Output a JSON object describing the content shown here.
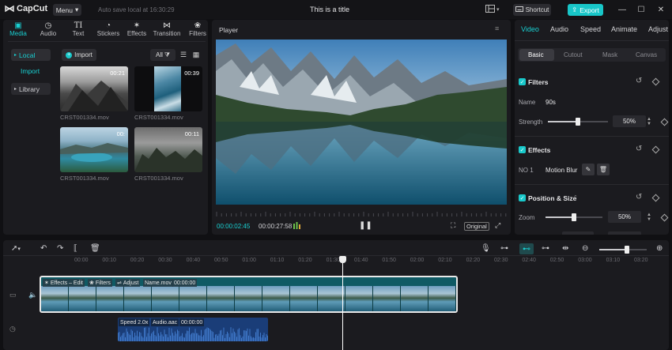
{
  "app": {
    "name": "CapCut",
    "menu_label": "Menu",
    "autosave": "Auto save local at 16:30:29",
    "title": "This is a title",
    "shortcut_label": "Shortcut",
    "export_label": "Export"
  },
  "media_tabs": [
    {
      "label": "Media",
      "icon": "media-icon"
    },
    {
      "label": "Audio",
      "icon": "audio-icon"
    },
    {
      "label": "Text",
      "icon": "text-icon"
    },
    {
      "label": "Stickers",
      "icon": "stickers-icon"
    },
    {
      "label": "Effects",
      "icon": "effects-icon"
    },
    {
      "label": "Transition",
      "icon": "transition-icon"
    },
    {
      "label": "Filters",
      "icon": "filters-icon"
    }
  ],
  "media_sidebar": {
    "local": "Local",
    "import": "Import",
    "library": "Library"
  },
  "media_toolbar": {
    "import": "Import",
    "filter_all": "All"
  },
  "media_items": [
    {
      "name": "CRST001334.mov",
      "duration": "00:21"
    },
    {
      "name": "CRST001334.mov",
      "duration": "00:39"
    },
    {
      "name": "CRST001334.mov",
      "duration": "00:"
    },
    {
      "name": "CRST001334.mov",
      "duration": "00:11"
    }
  ],
  "player": {
    "title": "Player",
    "current_time": "00:00:02:45",
    "total_time": "00:00:27:58",
    "original_label": "Original"
  },
  "props": {
    "tabs": [
      "Video",
      "Audio",
      "Speed",
      "Animate",
      "Adjust"
    ],
    "sub_tabs": [
      "Basic",
      "Cutout",
      "Mask",
      "Canvas"
    ],
    "filters": {
      "title": "Filters",
      "name_label": "Name",
      "name_value": "90s",
      "strength_label": "Strength",
      "strength_value": "50%",
      "strength_level": 0.5
    },
    "effects": {
      "title": "Effects",
      "item_label": "NO 1",
      "item_value": "Motion Blur"
    },
    "position": {
      "title": "Position & Size",
      "zoom_label": "Zoom",
      "zoom_value": "50%",
      "zoom_level": 0.5
    }
  },
  "timeline": {
    "ruler": [
      "00:00",
      "00:10",
      "00:20",
      "00:30",
      "00:40",
      "00:50",
      "01:00",
      "01:10",
      "01:20",
      "01:30",
      "01:40",
      "01:50",
      "02:00",
      "02:10",
      "02:20",
      "02:30",
      "02:40",
      "02:50",
      "03:00",
      "03:10",
      "03:20"
    ],
    "video_clip": {
      "effects_label": "Effects – Edit",
      "filters_label": "Filters",
      "adjust_label": "Adjust",
      "name_label": "Name.mov",
      "time_label": "00:00:00"
    },
    "audio_clip": {
      "speed_label": "Speed 2.0x",
      "name_label": "Audio.aac",
      "time_label": "00:00:00"
    }
  }
}
